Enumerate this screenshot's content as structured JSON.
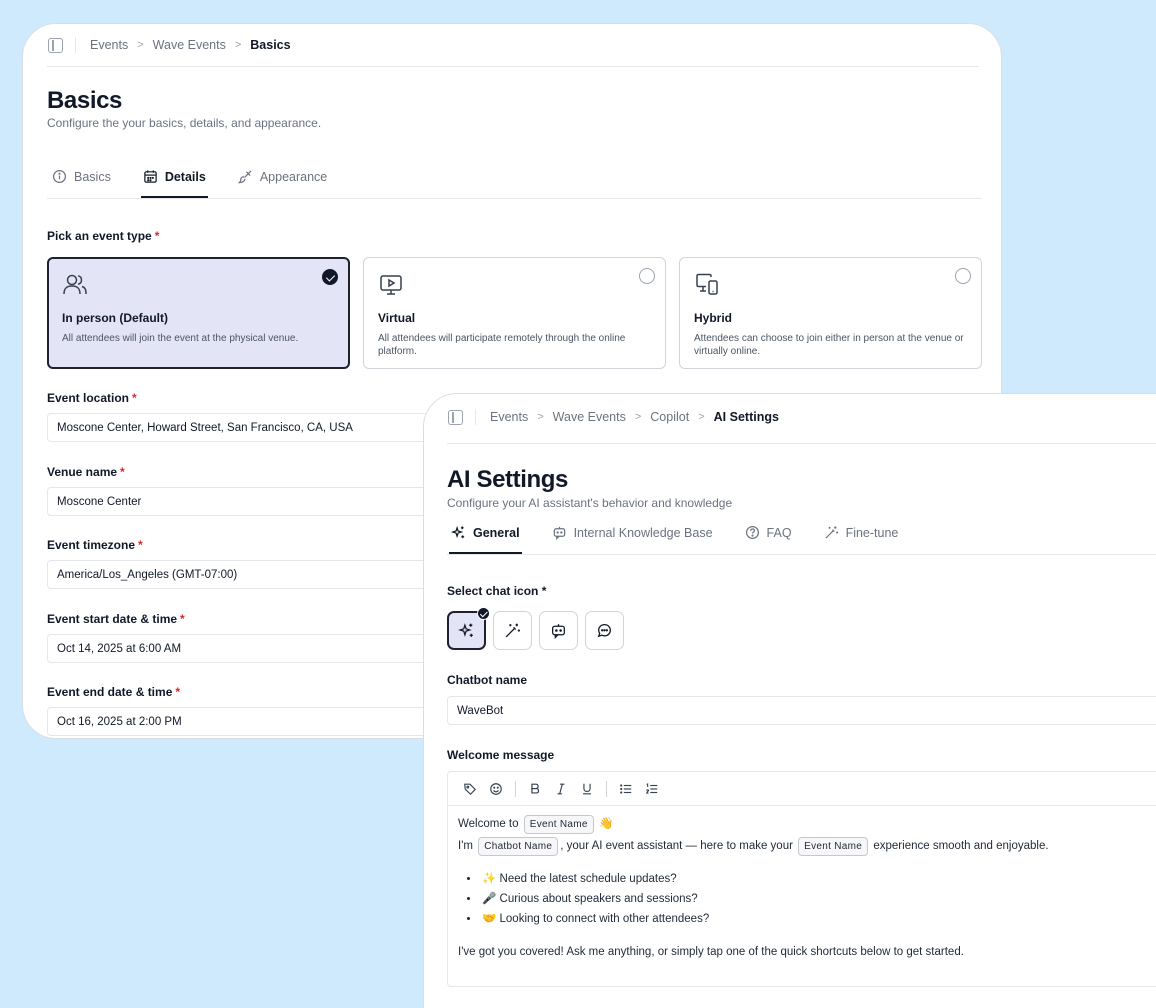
{
  "basics_window": {
    "breadcrumb": [
      "Events",
      "Wave Events",
      "Basics"
    ],
    "title": "Basics",
    "subtitle": "Configure the your basics, details, and appearance.",
    "tabs": [
      {
        "label": "Basics",
        "icon": "info-icon"
      },
      {
        "label": "Details",
        "icon": "calendar-icon",
        "active": true
      },
      {
        "label": "Appearance",
        "icon": "brush-icon"
      }
    ],
    "event_type": {
      "label": "Pick an event type",
      "options": [
        {
          "title": "In person (Default)",
          "desc": "All attendees will join the event at the physical venue.",
          "icon": "users-icon",
          "selected": true
        },
        {
          "title": "Virtual",
          "desc": "All attendees will participate remotely through the online platform.",
          "icon": "monitor-play-icon",
          "selected": false
        },
        {
          "title": "Hybrid",
          "desc": "Attendees can choose to join either in person at the venue or virtually online.",
          "icon": "devices-icon",
          "selected": false
        }
      ]
    },
    "fields": {
      "location": {
        "label": "Event location",
        "value": "Moscone Center, Howard Street, San Francisco, CA, USA"
      },
      "venue": {
        "label": "Venue name",
        "value": "Moscone Center"
      },
      "timezone": {
        "label": "Event timezone",
        "value": "America/Los_Angeles (GMT-07:00)"
      },
      "start": {
        "label": "Event start date & time",
        "value": "Oct 14, 2025 at 6:00 AM"
      },
      "end": {
        "label": "Event end date & time",
        "value": "Oct 16, 2025 at 2:00 PM"
      }
    },
    "required_mark": "*"
  },
  "ai_window": {
    "breadcrumb": [
      "Events",
      "Wave Events",
      "Copilot",
      "AI Settings"
    ],
    "title": "AI Settings",
    "subtitle": "Configure your AI assistant's behavior and knowledge",
    "tabs": [
      {
        "label": "General",
        "icon": "sparkles-icon",
        "active": true
      },
      {
        "label": "Internal Knowledge Base",
        "icon": "chat-bot-icon"
      },
      {
        "label": "FAQ",
        "icon": "help-circle-icon"
      },
      {
        "label": "Fine-tune",
        "icon": "wand-icon"
      }
    ],
    "chat_icon": {
      "label": "Select chat icon *",
      "options": [
        "sparkles-icon",
        "magic-wand-icon",
        "bot-message-icon",
        "message-circle-icon"
      ],
      "selected_index": 0
    },
    "chatbot_name": {
      "label": "Chatbot name",
      "value": "WaveBot"
    },
    "welcome": {
      "label": "Welcome message",
      "toolbar": [
        "tag-icon",
        "emoji-icon",
        "bold-icon",
        "italic-icon",
        "underline-icon",
        "bullet-list-icon",
        "numbered-list-icon"
      ],
      "line1_prefix": "Welcome to",
      "chip_event": "Event Name",
      "wave_emoji": "👋",
      "line2_prefix": "I'm",
      "chip_bot": "Chatbot Name",
      "line2_mid": ", your AI event assistant — here to make your",
      "line2_suffix": "experience smooth and enjoyable.",
      "bullets": [
        "✨ Need the latest schedule updates?",
        "🎤 Curious about speakers and sessions?",
        "🤝 Looking to connect with other attendees?"
      ],
      "closing": "I've got you covered! Ask me anything, or simply tap one of the quick shortcuts below to get started."
    }
  }
}
